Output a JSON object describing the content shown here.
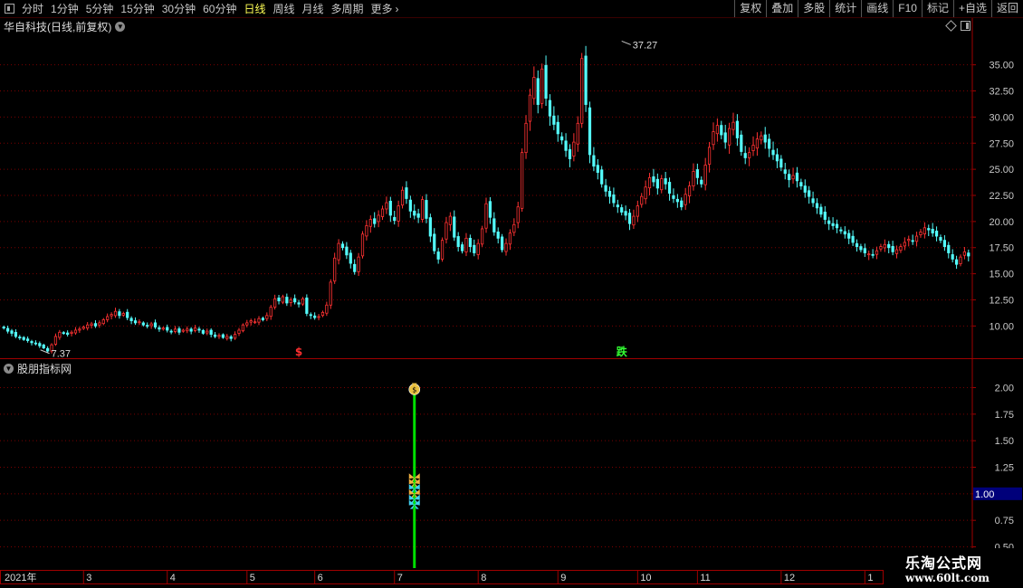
{
  "toolbar": {
    "periods": [
      {
        "label": "分时",
        "active": false
      },
      {
        "label": "1分钟",
        "active": false
      },
      {
        "label": "5分钟",
        "active": false
      },
      {
        "label": "15分钟",
        "active": false
      },
      {
        "label": "30分钟",
        "active": false
      },
      {
        "label": "60分钟",
        "active": false
      },
      {
        "label": "日线",
        "active": true
      },
      {
        "label": "周线",
        "active": false
      },
      {
        "label": "月线",
        "active": false
      },
      {
        "label": "多周期",
        "active": false
      },
      {
        "label": "更多",
        "active": false
      }
    ],
    "more_arrow": "›",
    "right_buttons": [
      "复权",
      "叠加",
      "多股",
      "统计",
      "画线",
      "F10",
      "标记",
      "+自选",
      "返回"
    ]
  },
  "main_panel": {
    "title": "华自科技(日线,前复权)"
  },
  "indicator_panel": {
    "title": "股朋指标网"
  },
  "watermark": {
    "line1": "乐淘公式网",
    "line2": "www.60lt.com"
  },
  "colors": {
    "up": "#ff3232",
    "down": "#54fcfc",
    "grid": "#7a0000",
    "axis": "#a00000",
    "green_bar": "#00e000",
    "label_box": "#00007a"
  },
  "chart_data": [
    {
      "type": "candlestick",
      "y_ticks": [
        10.0,
        12.5,
        15.0,
        17.5,
        20.0,
        22.5,
        25.0,
        27.5,
        30.0,
        32.5,
        35.0
      ],
      "ylim": [
        7.0,
        38.0
      ],
      "annotations": {
        "high": "37.27",
        "low": "7.37",
        "signal_buy": "$",
        "signal_sell": "跌"
      },
      "anchors": {
        "high_index": 155,
        "low_index": 11,
        "buy_index": 74,
        "sell_index": 155
      },
      "closes": [
        9.8,
        9.5,
        9.3,
        9.0,
        8.9,
        8.7,
        8.6,
        8.4,
        8.3,
        8.1,
        7.9,
        7.6,
        8.2,
        9.0,
        9.4,
        9.3,
        9.2,
        9.4,
        9.6,
        9.7,
        9.9,
        10.1,
        10.2,
        10.0,
        10.3,
        10.6,
        10.9,
        11.1,
        11.4,
        11.0,
        11.2,
        10.8,
        10.5,
        10.3,
        10.4,
        10.1,
        10.0,
        10.2,
        9.9,
        9.7,
        9.8,
        9.6,
        9.5,
        9.7,
        9.4,
        9.6,
        9.7,
        9.5,
        9.8,
        9.6,
        9.3,
        9.5,
        9.2,
        9.0,
        9.1,
        8.9,
        9.0,
        8.8,
        9.2,
        9.6,
        10.1,
        10.3,
        10.5,
        10.4,
        10.7,
        10.6,
        11.0,
        11.8,
        12.6,
        12.4,
        12.8,
        12.2,
        12.5,
        12.3,
        12.1,
        12.6,
        11.2,
        11.0,
        10.8,
        10.9,
        11.3,
        12.0,
        14.2,
        16.5,
        17.9,
        17.5,
        16.8,
        16.0,
        15.2,
        16.6,
        18.8,
        19.6,
        20.2,
        19.8,
        20.6,
        21.2,
        21.8,
        20.6,
        20.1,
        21.5,
        23.0,
        22.2,
        21.0,
        20.6,
        20.4,
        22.1,
        20.3,
        18.6,
        17.2,
        16.4,
        18.2,
        19.9,
        20.5,
        18.5,
        17.6,
        17.2,
        18.4,
        17.6,
        17.0,
        17.9,
        19.3,
        21.7,
        20.4,
        19.0,
        18.4,
        17.3,
        17.9,
        18.9,
        19.7,
        21.4,
        26.6,
        29.4,
        32.1,
        33.8,
        31.2,
        34.6,
        31.8,
        30.1,
        29.3,
        28.4,
        27.8,
        26.8,
        26.0,
        27.6,
        29.4,
        35.6,
        31.2,
        26.4,
        25.3,
        24.7,
        23.6,
        22.9,
        22.4,
        21.8,
        21.4,
        20.9,
        20.6,
        19.8,
        20.5,
        21.5,
        22.4,
        23.3,
        24.2,
        23.8,
        23.2,
        24.1,
        23.6,
        22.7,
        22.2,
        21.9,
        21.4,
        22.6,
        23.4,
        24.8,
        24.2,
        23.6,
        25.4,
        27.1,
        28.6,
        29.2,
        28.3,
        27.6,
        28.9,
        29.5,
        28.0,
        26.7,
        26.1,
        26.6,
        27.3,
        27.9,
        28.2,
        27.6,
        27.0,
        26.4,
        25.8,
        25.2,
        24.6,
        24.0,
        24.4,
        23.9,
        23.4,
        22.8,
        22.4,
        21.8,
        21.3,
        20.7,
        20.2,
        19.8,
        19.6,
        19.4,
        19.1,
        18.8,
        18.4,
        18.0,
        17.6,
        17.3,
        17.0,
        16.9,
        16.8,
        17.2,
        17.6,
        17.8,
        17.5,
        17.1,
        17.3,
        17.6,
        18.0,
        18.3,
        18.1,
        18.6,
        19.0,
        19.4,
        19.2,
        18.9,
        18.6,
        18.2,
        17.6,
        17.0,
        16.4,
        15.9,
        16.6,
        17.1,
        16.7
      ]
    },
    {
      "type": "signal",
      "y_ticks": [
        0.5,
        0.75,
        1.0,
        1.25,
        1.5,
        1.75,
        2.0
      ],
      "ylim": [
        0.3,
        2.2
      ],
      "current_value": "1.00",
      "bar": {
        "index": 103,
        "from": 0,
        "to": 2.0
      },
      "icons": [
        {
          "name": "money-bag-icon",
          "value": 2.0,
          "color": "#e8c040"
        },
        {
          "name": "butterfly-icon",
          "value": 1.15,
          "color": "#f0b040"
        },
        {
          "name": "butterfly-icon",
          "value": 1.1,
          "color": "#f0b040"
        },
        {
          "name": "butterfly-icon",
          "value": 1.05,
          "color": "#40d0f0"
        },
        {
          "name": "butterfly-icon",
          "value": 1.0,
          "color": "#f0b040"
        },
        {
          "name": "butterfly-icon",
          "value": 0.95,
          "color": "#40d0f0"
        },
        {
          "name": "butterfly-icon",
          "value": 0.9,
          "color": "#40d0f0"
        }
      ]
    }
  ],
  "x_axis": {
    "labels": [
      {
        "text": "2021年",
        "index": 0
      },
      {
        "text": "3",
        "index": 20
      },
      {
        "text": "4",
        "index": 41
      },
      {
        "text": "5",
        "index": 61
      },
      {
        "text": "6",
        "index": 78
      },
      {
        "text": "7",
        "index": 98
      },
      {
        "text": "8",
        "index": 119
      },
      {
        "text": "9",
        "index": 139
      },
      {
        "text": "10",
        "index": 159
      },
      {
        "text": "11",
        "index": 174
      },
      {
        "text": "12",
        "index": 195
      },
      {
        "text": "1",
        "index": 216
      }
    ]
  }
}
